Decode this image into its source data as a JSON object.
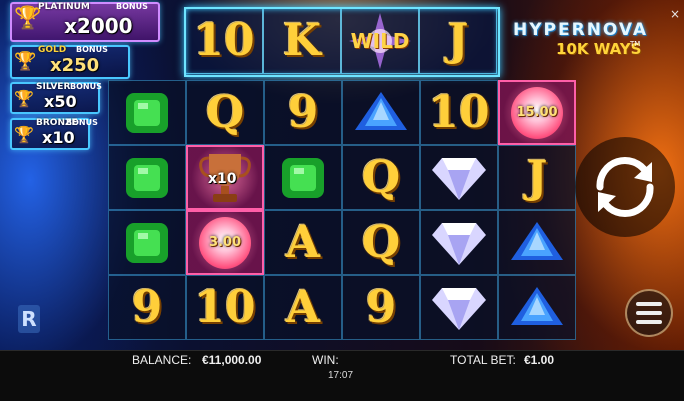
{
  "game": {
    "logo_line1": "HYPERNOVA",
    "logo_line2": "10K WAYS",
    "logo_tm": "TM"
  },
  "bonus": {
    "platinum": {
      "name": "PLATINUM",
      "tag": "BONUS",
      "multiplier": "x2000"
    },
    "gold": {
      "name": "GOLD",
      "tag": "BONUS",
      "multiplier": "x250"
    },
    "silver": {
      "name": "SILVER",
      "tag": "BONUS",
      "multiplier": "x50"
    },
    "bronze": {
      "name": "BRONZE",
      "tag": "BONUS",
      "multiplier": "x10"
    }
  },
  "top_reel": [
    "10",
    "K",
    "WILD",
    "J"
  ],
  "grid": {
    "row1": [
      "green-emerald",
      "Q",
      "9",
      "blue-gem",
      "10",
      "15.00"
    ],
    "row2": [
      "green-emerald",
      "x10",
      "green-emerald",
      "Q",
      "diamond",
      "J"
    ],
    "row3": [
      "green-emerald",
      "3.00",
      "A",
      "Q",
      "diamond",
      "blue-gem"
    ],
    "row4": [
      "9",
      "10",
      "A",
      "9",
      "diamond",
      "blue-gem"
    ]
  },
  "status_bar": {
    "balance_label": "BALANCE:",
    "balance_value": "€11,000.00",
    "win_label": "WIN:",
    "win_value": "",
    "total_bet_label": "TOTAL BET:",
    "total_bet_value": "€1.00",
    "clock": "17:07"
  },
  "icons": {
    "close": "close-icon",
    "spin": "spin-icon",
    "menu": "menu-icon",
    "provider": "provider-logo",
    "close_glyph": "×",
    "provider_glyph": "R"
  },
  "colors": {
    "gold": "#ffcf3a",
    "frame": "#6ee4ff",
    "hot": "#ff5fa8"
  }
}
